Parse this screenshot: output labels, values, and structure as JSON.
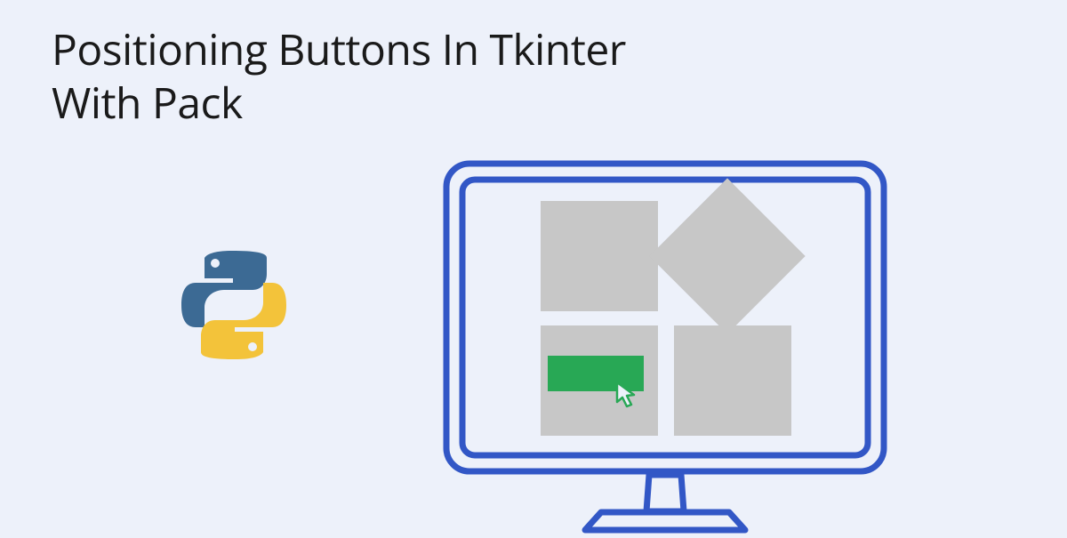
{
  "title_line1": "Positioning Buttons In Tkinter",
  "title_line2": "With Pack",
  "colors": {
    "background": "#edf1fa",
    "monitor_outline": "#3257c6",
    "shape_gray": "#c7c7c7",
    "button_green": "#28a855",
    "python_blue": "#3c6a94",
    "python_yellow": "#f3c33a"
  },
  "illustration": {
    "type": "monitor-with-shapes",
    "description": "Computer monitor illustration showing four gray shapes (two squares, one diamond, one square with green button and cursor)"
  }
}
